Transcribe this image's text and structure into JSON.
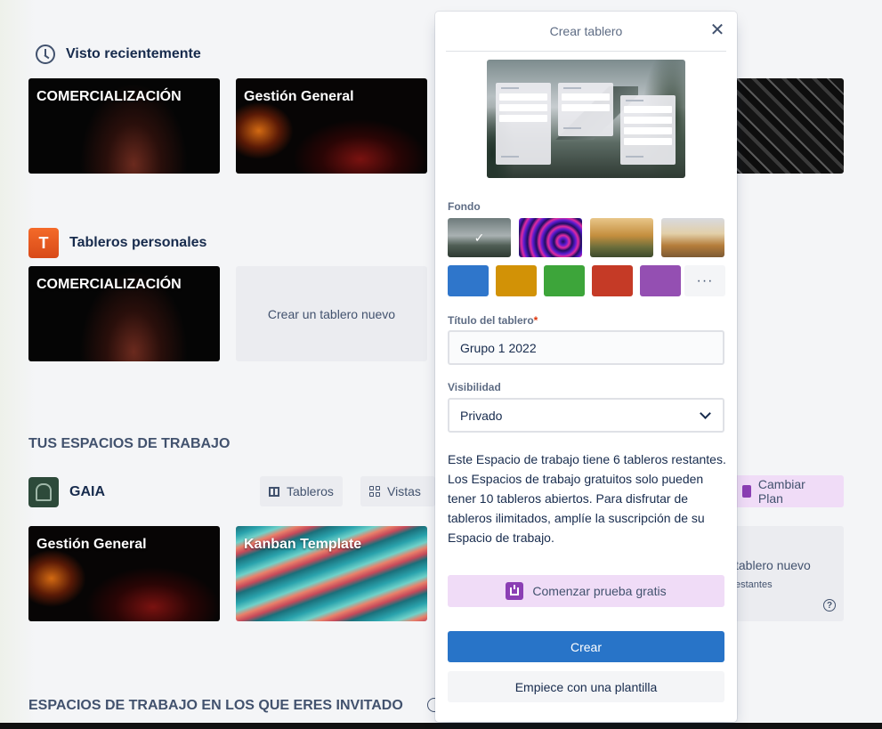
{
  "recent": {
    "heading": "Visto recientemente",
    "tiles": [
      {
        "title": "COMERCIALIZACIÓN"
      },
      {
        "title": "Gestión General"
      }
    ]
  },
  "personal": {
    "badge_letter": "T",
    "heading": "Tableros personales",
    "tile_title": "COMERCIALIZACIÓN",
    "create_new": "Crear un tablero nuevo"
  },
  "workspaces": {
    "heading": "TUS ESPACIOS DE TRABAJO",
    "name": "GAIA",
    "boards_btn": "Tableros",
    "views_btn": "Vistas",
    "upgrade_btn": "Cambiar Plan",
    "tiles": [
      {
        "title": "Gestión General"
      },
      {
        "title": "Kanban Template"
      }
    ],
    "new_board_partial": "tablero nuevo",
    "remaining_partial": "estantes",
    "help_glyph": "?"
  },
  "guest": {
    "heading": "ESPACIOS DE TRABAJO EN LOS QUE ERES INVITADO"
  },
  "popover": {
    "title": "Crear tablero",
    "close_glyph": "✕",
    "background_label": "Fondo",
    "selected_check": "✓",
    "colors": [
      "#2f76cb",
      "#d29206",
      "#3da53a",
      "#c53a26",
      "#944fb2"
    ],
    "more_glyph": "···",
    "title_label": "Título del tablero",
    "required_mark": "*",
    "title_value": "Grupo 1 2022",
    "visibility_label": "Visibilidad",
    "visibility_value": "Privado",
    "info_text": "Este Espacio de trabajo tiene 6 tableros restantes. Los Espacios de trabajo gratuitos solo pueden tener 10 tableros abiertos. Para disfrutar de tableros ilimitados, amplíe la suscripción de su Espacio de trabajo.",
    "trial_btn": "Comenzar prueba gratis",
    "create_btn": "Crear",
    "template_btn": "Empiece con una plantilla"
  }
}
